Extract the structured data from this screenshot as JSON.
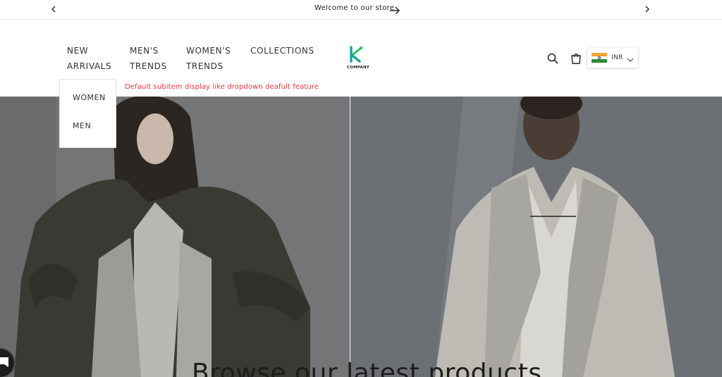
{
  "announcement": {
    "message": "Welcome to our store",
    "prev_icon": "chevron-left-icon",
    "next_icon": "chevron-right-icon",
    "arrow_icon": "arrow-right-icon"
  },
  "nav": {
    "items": [
      {
        "line1": "NEW",
        "line2": "ARRIVALS"
      },
      {
        "line1": "MEN'S",
        "line2": "TRENDS"
      },
      {
        "line1": "WOMEN'S",
        "line2": "TRENDS"
      },
      {
        "line1": "COLLECTIONS",
        "line2": ""
      }
    ],
    "dropdown": [
      "WOMEN",
      "MEN"
    ]
  },
  "logo": {
    "wordmark": "COMPANY"
  },
  "header_icons": {
    "search": "search-icon",
    "cart": "cart-icon"
  },
  "currency": {
    "code": "INR",
    "flag": "india-flag-icon",
    "chevron": "chevron-down-icon"
  },
  "note": "Default subitem display like dropdown deafult feature",
  "hero": {
    "title": "Browse our latest products"
  },
  "colors": {
    "accent_green": "#22c55e",
    "logo_teal": "#1aa6a0",
    "note_red": "#e53935"
  }
}
